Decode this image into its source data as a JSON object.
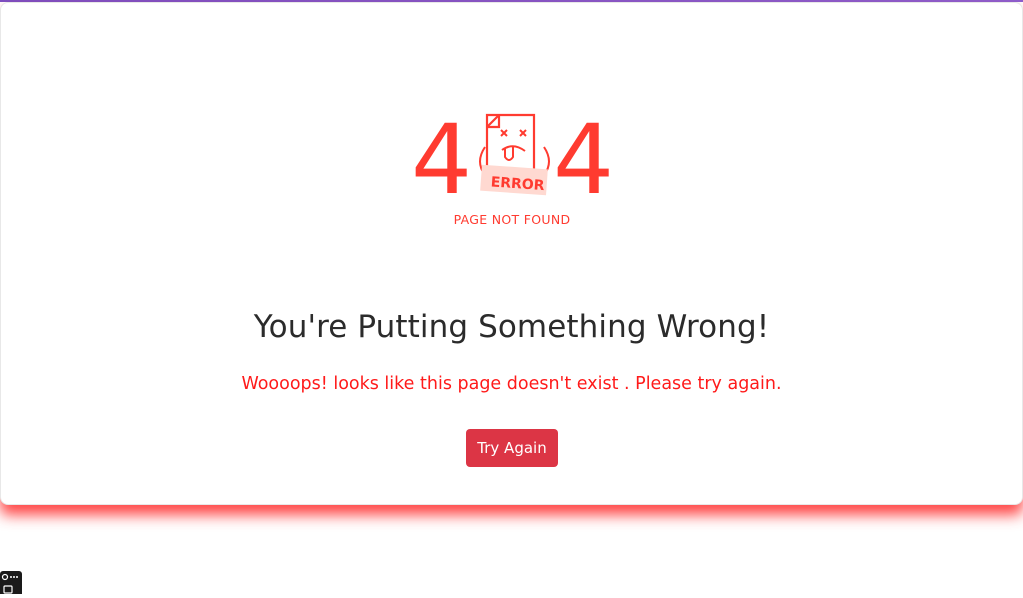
{
  "illustration": {
    "digit_left": "4",
    "digit_right": "4",
    "error_tag": "ERROR",
    "caption": "PAGE NOT FOUND",
    "icon": "broken-page-face-icon"
  },
  "main": {
    "headline": "You're Putting Something Wrong!",
    "message": "Woooops! looks like this page doesn't exist . Please try again.",
    "button_label": "Try Again"
  },
  "colors": {
    "accent_red": "#ff3b30",
    "button_red": "#dc3545",
    "message_red": "#ff1a1a",
    "headline": "#2b2b2b",
    "tag_fill": "#ffd9d1",
    "top_border": "#7a4fc3"
  },
  "dev_badge": {
    "icon": "devtools-icon"
  }
}
